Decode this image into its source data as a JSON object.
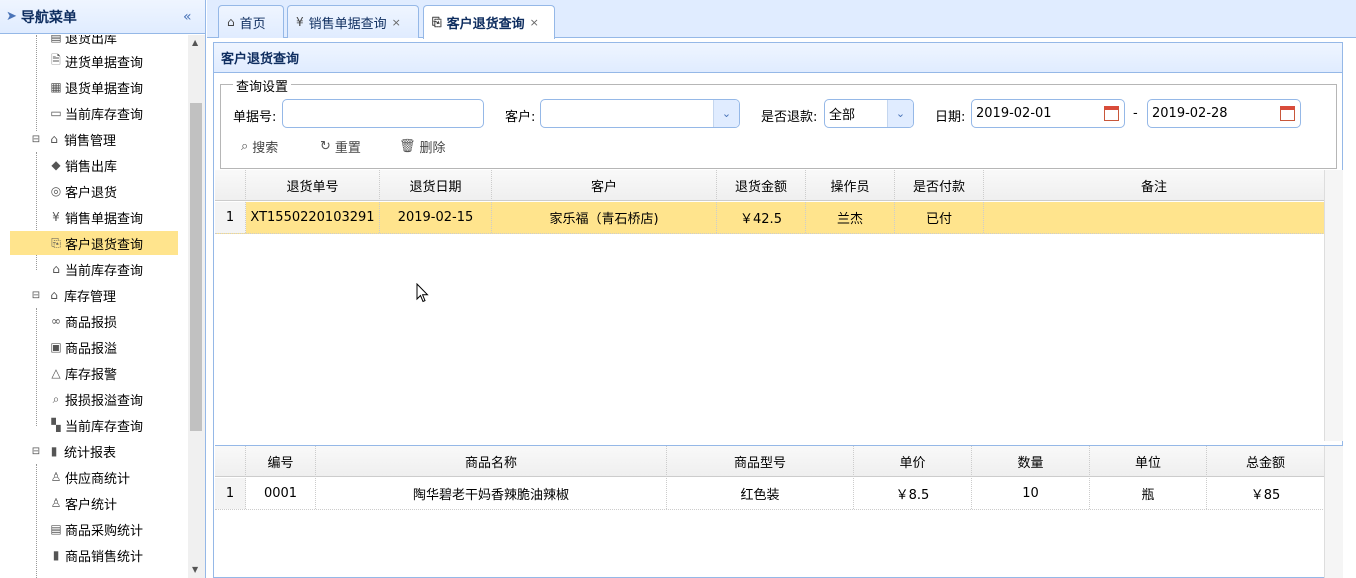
{
  "sidebar": {
    "title": "导航菜单",
    "collapse_icon": "double-chevron-left-icon",
    "items": [
      {
        "label": "退货出库",
        "type": "leaf",
        "icon": "doc-icon"
      },
      {
        "label": "进货单据查询",
        "type": "leaf",
        "icon": "doc-search-icon"
      },
      {
        "label": "退货单据查询",
        "type": "leaf",
        "icon": "calendar-doc-icon"
      },
      {
        "label": "当前库存查询",
        "type": "leaf",
        "icon": "box-icon"
      },
      {
        "label": "销售管理",
        "type": "group",
        "icon": "store-icon"
      },
      {
        "label": "销售出库",
        "type": "leaf",
        "icon": "tag-icon"
      },
      {
        "label": "客户退货",
        "type": "leaf",
        "icon": "return-icon"
      },
      {
        "label": "销售单据查询",
        "type": "leaf",
        "icon": "yen-doc-icon"
      },
      {
        "label": "客户退货查询",
        "type": "leaf",
        "icon": "return-doc-icon",
        "selected": true
      },
      {
        "label": "当前库存查询",
        "type": "leaf",
        "icon": "warehouse-icon"
      },
      {
        "label": "库存管理",
        "type": "group",
        "icon": "home-icon"
      },
      {
        "label": "商品报损",
        "type": "leaf",
        "icon": "glasses-icon"
      },
      {
        "label": "商品报溢",
        "type": "leaf",
        "icon": "image-icon"
      },
      {
        "label": "库存报警",
        "type": "leaf",
        "icon": "bell-icon"
      },
      {
        "label": "报损报溢查询",
        "type": "leaf",
        "icon": "search-icon"
      },
      {
        "label": "当前库存查询",
        "type": "leaf",
        "icon": "grid-icon"
      },
      {
        "label": "统计报表",
        "type": "group",
        "icon": "bar-chart-icon"
      },
      {
        "label": "供应商统计",
        "type": "leaf",
        "icon": "user-icon"
      },
      {
        "label": "客户统计",
        "type": "leaf",
        "icon": "users-icon"
      },
      {
        "label": "商品采购统计",
        "type": "leaf",
        "icon": "doc-edit-icon"
      },
      {
        "label": "商品销售统计",
        "type": "leaf",
        "icon": "bar-chart-icon"
      }
    ]
  },
  "tabs": [
    {
      "label": "首页",
      "icon": "home-icon",
      "closable": false
    },
    {
      "label": "销售单据查询",
      "icon": "yen-doc-icon",
      "closable": true
    },
    {
      "label": "客户退货查询",
      "icon": "return-doc-icon",
      "closable": true,
      "active": true
    }
  ],
  "panel": {
    "title": "客户退货查询",
    "query": {
      "legend": "查询设置",
      "bill_no_label": "单据号:",
      "bill_no_value": "",
      "customer_label": "客户:",
      "customer_value": "",
      "refund_label": "是否退款:",
      "refund_value": "全部",
      "date_label": "日期:",
      "date_from": "2019-02-01",
      "date_sep": "-",
      "date_to": "2019-02-28",
      "search_label": "搜索",
      "reset_label": "重置",
      "delete_label": "删除"
    }
  },
  "returns_grid": {
    "columns": [
      "退货单号",
      "退货日期",
      "客户",
      "退货金额",
      "操作员",
      "是否付款",
      "备注"
    ],
    "rows": [
      {
        "num": "1",
        "cells": [
          "XT1550220103291",
          "2019-02-15",
          "家乐福（青石桥店)",
          "￥42.5",
          "兰杰",
          "已付",
          ""
        ],
        "selected": true
      }
    ]
  },
  "items_grid": {
    "columns": [
      "编号",
      "商品名称",
      "商品型号",
      "单价",
      "数量",
      "单位",
      "总金额"
    ],
    "rows": [
      {
        "num": "1",
        "cells": [
          "0001",
          "陶华碧老干妈香辣脆油辣椒",
          "红色装",
          "￥8.5",
          "10",
          "瓶",
          "￥85"
        ]
      }
    ]
  },
  "colors": {
    "accent": "#95b8e7",
    "header_bg": "#e0ecff",
    "selected": "#ffe48d",
    "title_text": "#0e2d5f"
  }
}
